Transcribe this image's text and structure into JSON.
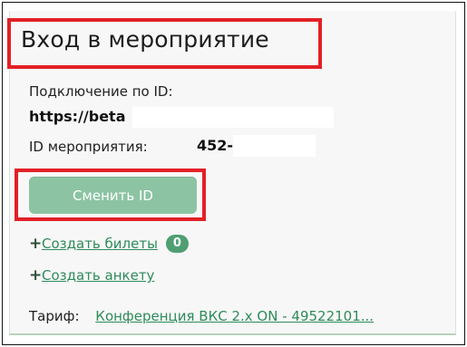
{
  "event": {
    "title": "Вход в мероприятие",
    "connection_label": "Подключение по ID:",
    "connection_value": "https://beta",
    "event_id_label": "ID мероприятия:",
    "event_id_value": "452-",
    "change_id_button": "Сменить ID"
  },
  "actions": {
    "create_tickets": "Создать билеты",
    "tickets_count": "0",
    "create_form": "Создать анкету"
  },
  "tariff": {
    "label": "Тариф:",
    "value": "Конференция ВКС 2.x ON - 49522101..."
  },
  "colors": {
    "highlight": "#e32027",
    "button": "#8cc4a3",
    "link": "#2e8b5a",
    "badge": "#4f9f73"
  },
  "icons": {
    "add": "plus-icon"
  }
}
